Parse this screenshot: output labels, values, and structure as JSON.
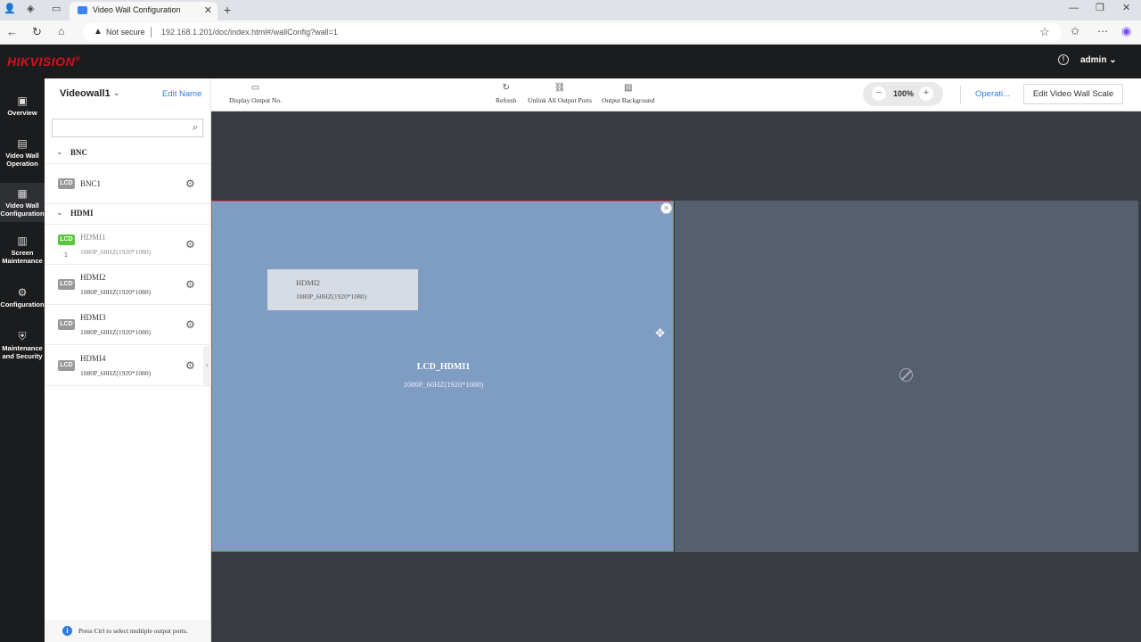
{
  "browser": {
    "tab_title": "Video Wall Configuration",
    "address_warning": "Not secure",
    "url": "192.168.1.201/doc/index.html#/wallConfig?wall=1"
  },
  "app": {
    "brand": "HIKVISION",
    "brand_mark": "®",
    "user": "admin",
    "accent_color": "#d4121e",
    "link_color": "#2f7de1"
  },
  "nav": [
    {
      "label": "Overview",
      "icon": "overview-icon"
    },
    {
      "label": "Video Wall Operation",
      "icon": "video-wall-operation-icon"
    },
    {
      "label": "Video Wall Configuration",
      "icon": "video-wall-config-icon",
      "active": true
    },
    {
      "label": "Screen Maintenance",
      "icon": "screen-maintenance-icon"
    },
    {
      "label": "Configuration",
      "icon": "gear-icon"
    },
    {
      "label": "Maintenance and Security",
      "icon": "maintenance-security-icon"
    }
  ],
  "panel": {
    "videowall_name": "Videowall1",
    "edit_name": "Edit Name",
    "search_placeholder": "",
    "groups": [
      {
        "label": "BNC",
        "ports": [
          {
            "name": "BNC1",
            "resolution": ""
          }
        ]
      },
      {
        "label": "HDMI",
        "ports": [
          {
            "name": "HDMI1",
            "resolution": "1080P_60HZ(1920*1080)",
            "bound": true,
            "number": "1"
          },
          {
            "name": "HDMI2",
            "resolution": "1080P_60HZ(1920*1080)"
          },
          {
            "name": "HDMI3",
            "resolution": "1080P_60HZ(1920*1080)"
          },
          {
            "name": "HDMI4",
            "resolution": "1080P_60HZ(1920*1080)"
          }
        ]
      }
    ],
    "lcd_badge": "LCD",
    "hint": "Press Ctrl to select multiple output ports."
  },
  "toolbar": {
    "display_output_no": "Display Output No.",
    "refresh": "Refresh",
    "unlink_all": "Unlink All Output Ports",
    "output_background": "Output Background",
    "zoom": "100%",
    "operation": "Operati...",
    "edit_scale": "Edit Video Wall Scale"
  },
  "canvas": {
    "screen1": {
      "title": "LCD_HDMI1",
      "resolution": "1080P_60HZ(1920*1080)",
      "window_name": "HDMI2",
      "window_resolution": "1080P_60HZ(1920*1080)"
    }
  }
}
